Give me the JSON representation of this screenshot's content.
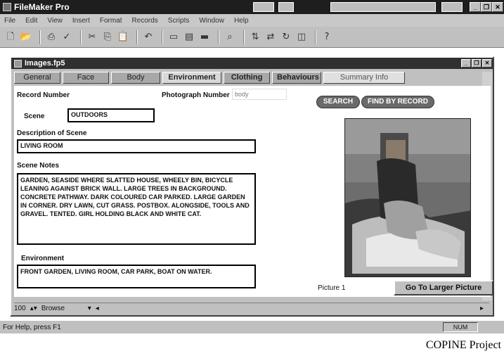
{
  "app": {
    "title": "FileMaker Pro"
  },
  "menu": [
    "File",
    "Edit",
    "View",
    "Insert",
    "Format",
    "Records",
    "Scripts",
    "Window",
    "Help"
  ],
  "document": {
    "title": "Images.fp5",
    "tabs": [
      {
        "label": "General",
        "state": "normal"
      },
      {
        "label": "Face",
        "state": "normal"
      },
      {
        "label": "Body",
        "state": "normal"
      },
      {
        "label": "Environment",
        "state": "active"
      },
      {
        "label": "Clothing",
        "state": "bold"
      },
      {
        "label": "Behaviours",
        "state": "bold"
      },
      {
        "label": "Summary Info",
        "state": "faint"
      }
    ],
    "form": {
      "record_number_label": "Record Number",
      "photograph_number_label": "Photograph Number",
      "photograph_number_value": "body",
      "scene_label": "Scene",
      "scene_value": "OUTDOORS",
      "description_label": "Description of Scene",
      "description_value": "LIVING ROOM",
      "notes_label": "Scene Notes",
      "notes_value": "GARDEN, SEASIDE WHERE SLATTED HOUSE, WHEELY BIN, BICYCLE LEANING AGAINST BRICK WALL. LARGE TREES IN BACKGROUND. CONCRETE PATHWAY. DARK COLOURED CAR PARKED. LARGE GARDEN IN CORNER. DRY LAWN, CUT GRASS. POSTBOX. ALONGSIDE, TOOLS AND GRAVEL. TENTED. GIRL HOLDING BLACK AND WHITE CAT.",
      "environment_label": "Environment",
      "environment_value": "FRONT GARDEN, LIVING ROOM, CAR PARK, BOAT ON WATER.",
      "search_button": "SEARCH",
      "find_button": "FIND BY RECORD",
      "picture_label": "Picture 1",
      "goto_button": "Go To Larger Picture"
    },
    "navbar": {
      "zoom": "100",
      "mode": "Browse"
    }
  },
  "status": {
    "help_text": "For Help, press F1",
    "num": "NUM"
  },
  "caption": "COPINE Project",
  "colors": {
    "title_bar": "#1e1e1e",
    "chrome": "#c0c0c0",
    "pill": "#6a6a6a"
  }
}
